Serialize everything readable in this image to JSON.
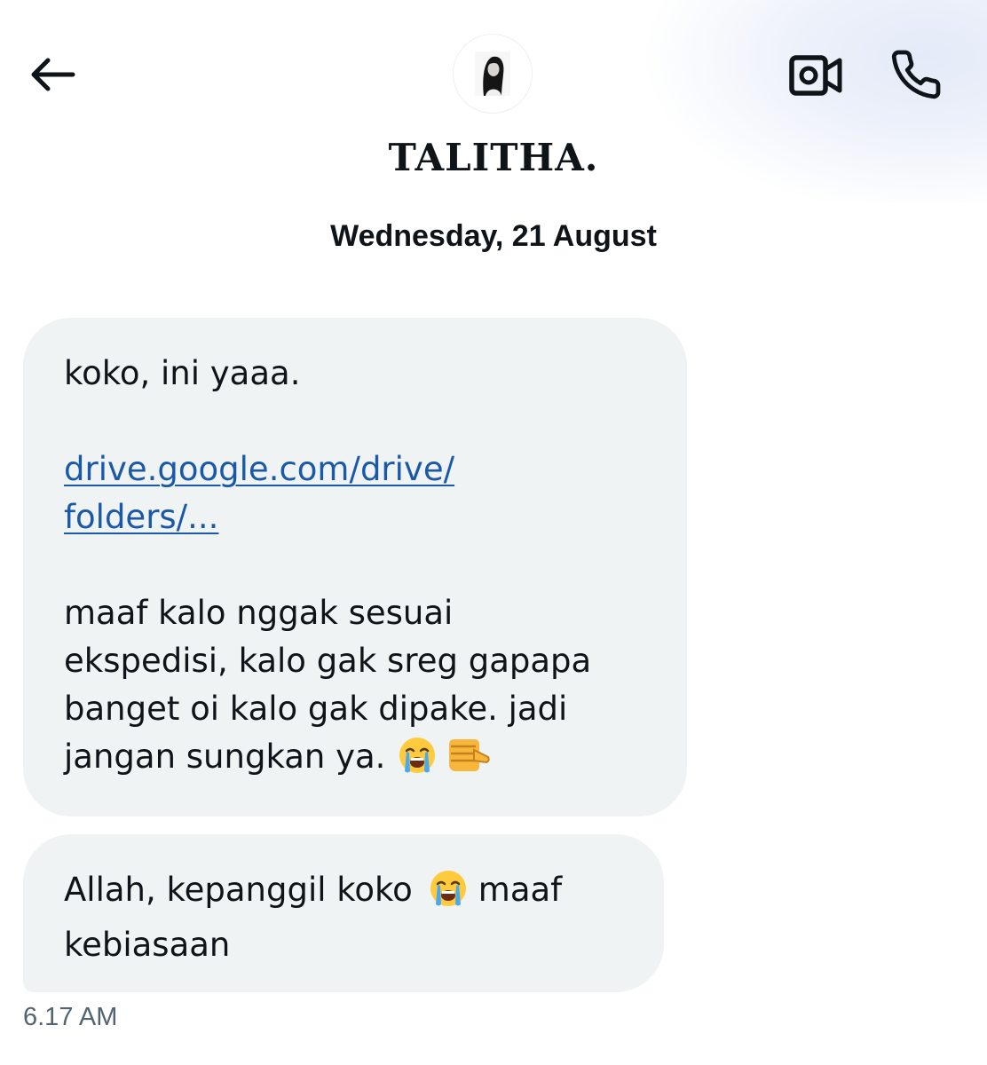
{
  "header": {
    "back_icon": "arrow-left-icon",
    "contact_name": "TALITHA.",
    "video_call_icon": "video-camera-icon",
    "voice_call_icon": "phone-icon"
  },
  "conversation": {
    "date_divider": "Wednesday, 21 August",
    "messages": [
      {
        "lines": [
          "koko, ini yaaa."
        ],
        "link_lines": [
          "drive.google.com/drive/",
          "folders/..."
        ],
        "body_lines": [
          "maaf kalo nggak sesuai",
          "ekspedisi, kalo gak sreg gapapa",
          "banget oi kalo gak dipake. jadi",
          "jangan sungkan ya."
        ],
        "emojis": [
          "crying-face-emoji",
          "pointing-fist-emoji"
        ]
      },
      {
        "line1_before": "Allah, kepanggil koko",
        "line1_after": "maaf",
        "line2": "kebiasaan",
        "emojis": [
          "crying-face-emoji"
        ]
      }
    ],
    "timestamp": "6.17 AM"
  },
  "colors": {
    "bubble_background": "#eff3f4",
    "link": "#1a59a8",
    "text": "#0f1419",
    "timestamp": "#536471"
  }
}
